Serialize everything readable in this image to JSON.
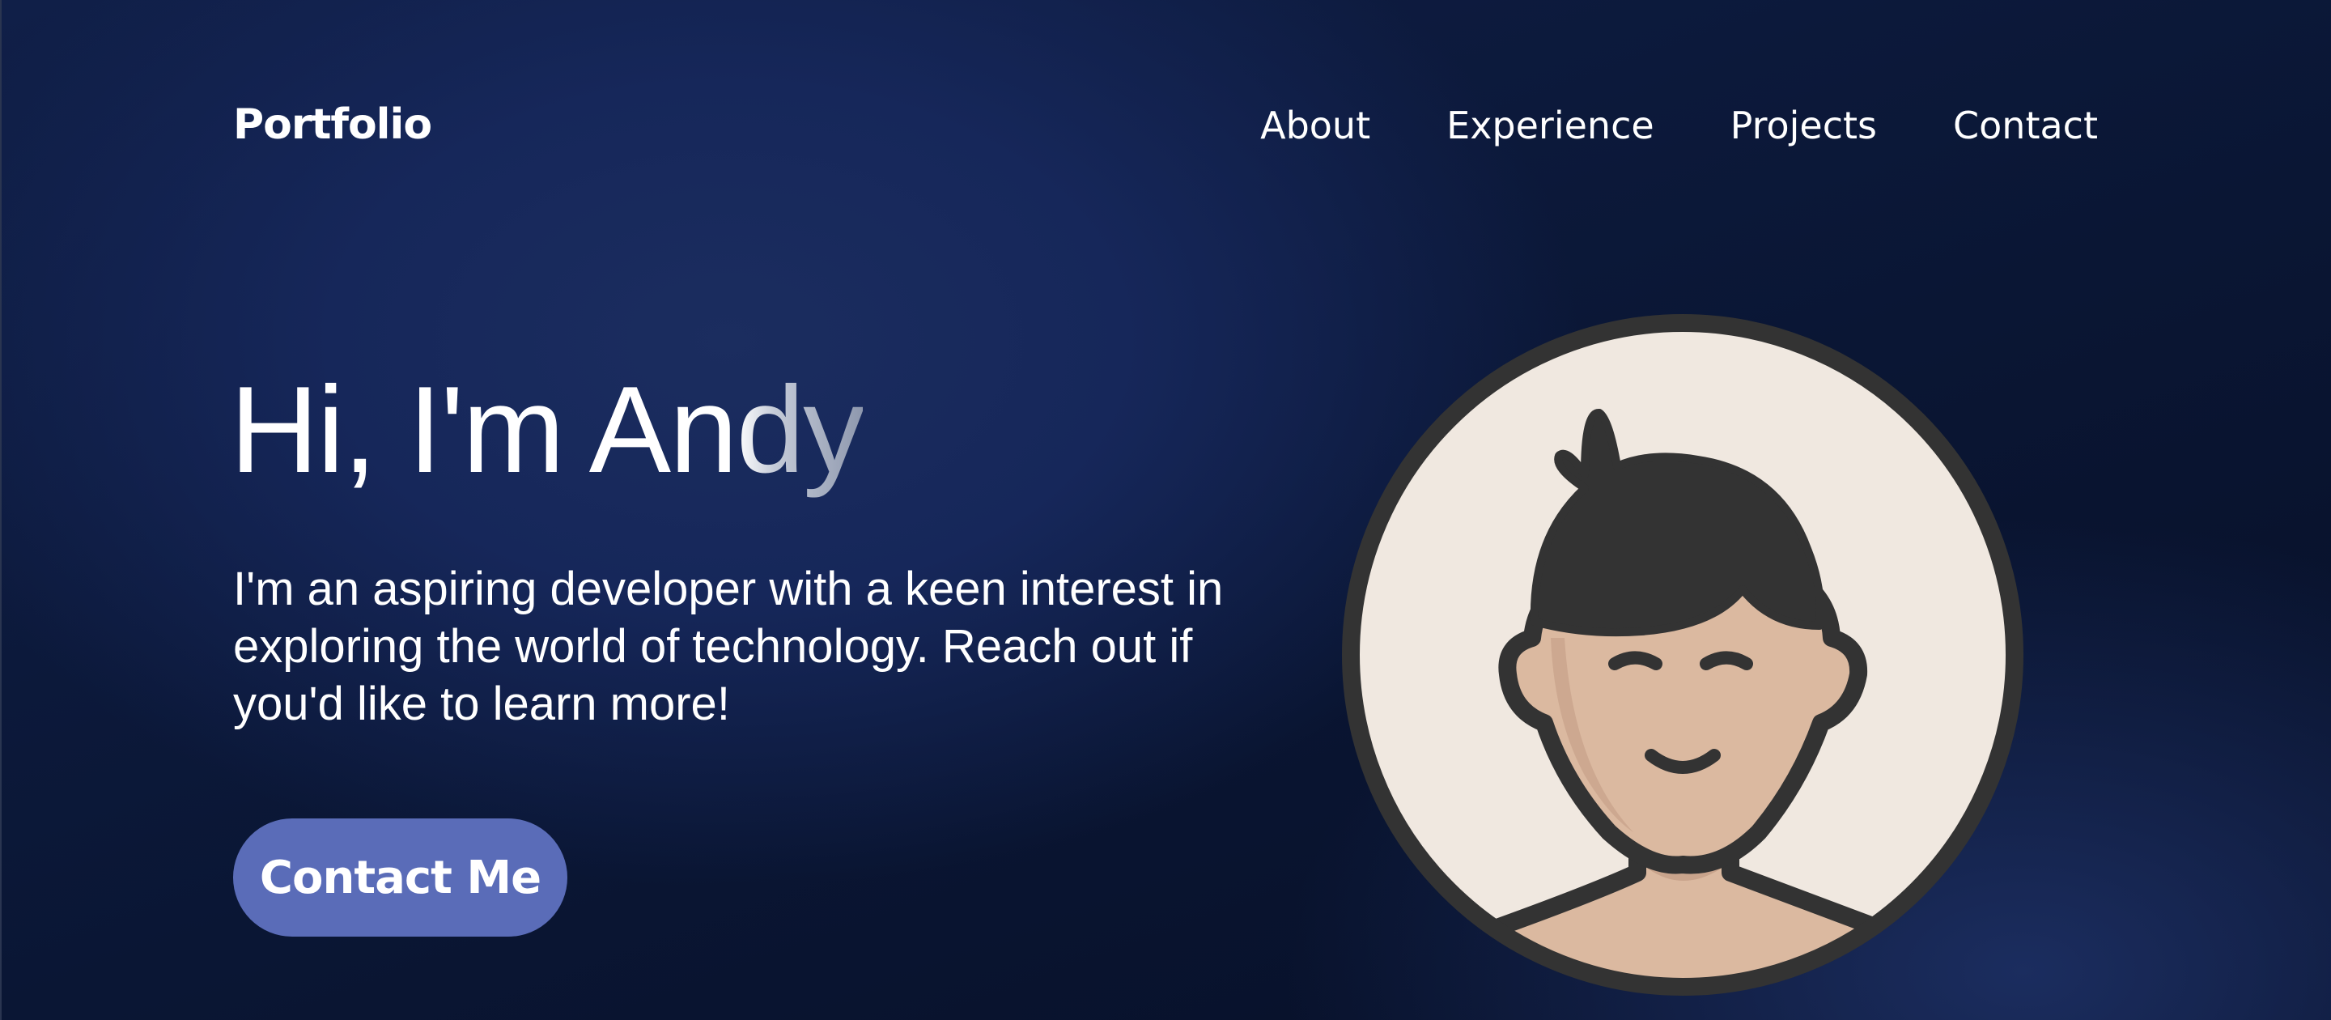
{
  "header": {
    "logo": "Portfolio",
    "nav": [
      "About",
      "Experience",
      "Projects",
      "Contact"
    ]
  },
  "hero": {
    "title_main": "Hi, I'm An",
    "title_fade": "dy",
    "description": "I'm an aspiring developer with a keen interest in exploring the world of technology. Reach out if you'd like to learn more!",
    "cta_label": "Contact Me"
  },
  "avatar": {
    "icon": "person-avatar-illustration"
  },
  "colors": {
    "background_dark": "#070f26",
    "background_light": "#1b2d5f",
    "accent_button": "#5a6cb8",
    "avatar_background": "#f0e8e0",
    "avatar_skin": "#dbb9a0",
    "avatar_outline": "#333333"
  }
}
